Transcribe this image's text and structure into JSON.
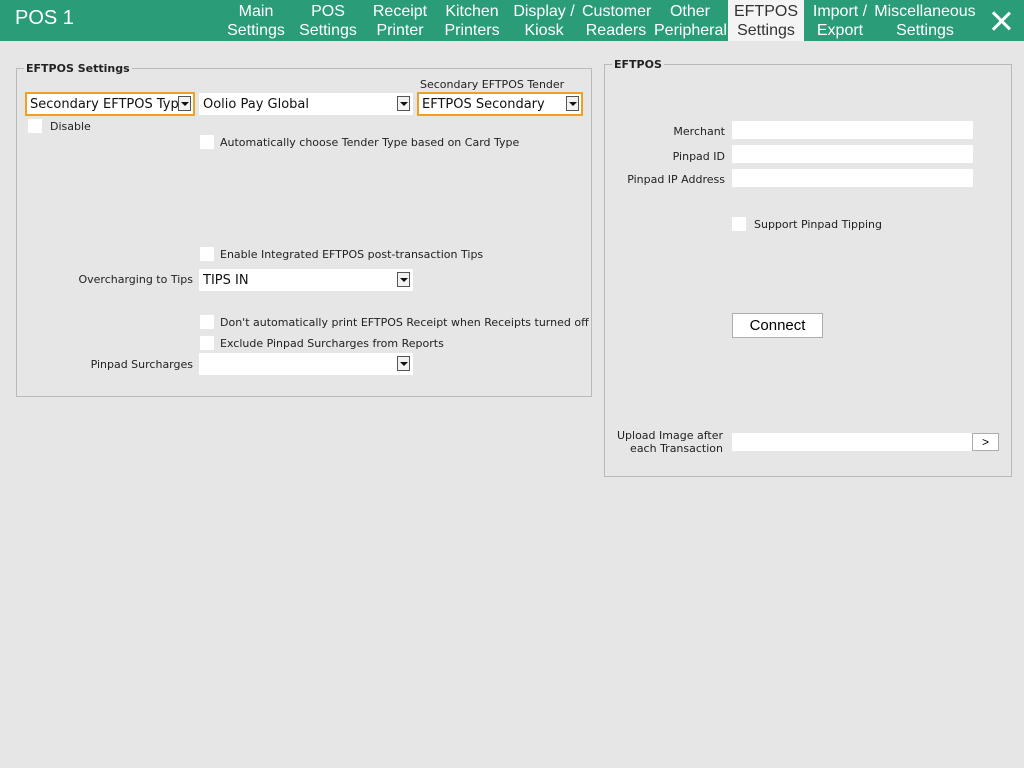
{
  "header": {
    "app_title": "POS 1",
    "tabs": [
      {
        "line1": "Main",
        "line2": "Settings"
      },
      {
        "line1": "POS",
        "line2": "Settings"
      },
      {
        "line1": "Receipt",
        "line2": "Printer"
      },
      {
        "line1": "Kitchen",
        "line2": "Printers"
      },
      {
        "line1": "Display /",
        "line2": "Kiosk"
      },
      {
        "line1": "Customer",
        "line2": "Readers"
      },
      {
        "line1": "Other",
        "line2": "Peripheral"
      },
      {
        "line1": "EFTPOS",
        "line2": "Settings"
      },
      {
        "line1": "Import /",
        "line2": "Export"
      },
      {
        "line1": "Miscellaneous",
        "line2": "Settings"
      }
    ],
    "active_tab": "EFTPOS Settings",
    "close_icon": "close-icon"
  },
  "eftpos_settings": {
    "title": "EFTPOS Settings",
    "type_combo": "Secondary EFTPOS Type",
    "provider_combo": "Oolio Pay Global",
    "secondary_tender_label": "Secondary EFTPOS Tender",
    "secondary_tender_combo": "EFTPOS Secondary",
    "disable_label": "Disable",
    "auto_tender_label": "Automatically choose Tender Type based on Card Type",
    "enable_tips_label": "Enable Integrated EFTPOS post-transaction Tips",
    "overcharging_label": "Overcharging to Tips",
    "overcharging_value": "TIPS IN",
    "no_print_label": "Don't automatically print EFTPOS Receipt when Receipts turned off",
    "exclude_surcharges_label": "Exclude Pinpad Surcharges from Reports",
    "pinpad_surcharges_label": "Pinpad Surcharges",
    "pinpad_surcharges_value": ""
  },
  "eftpos": {
    "title": "EFTPOS",
    "merchant_label": "Merchant",
    "merchant_value": "",
    "pinpad_id_label": "Pinpad ID",
    "pinpad_id_value": "",
    "pinpad_ip_label": "Pinpad IP Address",
    "pinpad_ip_value": "",
    "tipping_label": "Support Pinpad Tipping",
    "connect_label": "Connect",
    "upload_label_line1": "Upload Image after",
    "upload_label_line2": "each Transaction",
    "upload_value": "",
    "browse_label": ">"
  },
  "colors": {
    "header_bg": "#2a9d78",
    "highlight": "#f0a020",
    "background": "#e6e6e6"
  }
}
